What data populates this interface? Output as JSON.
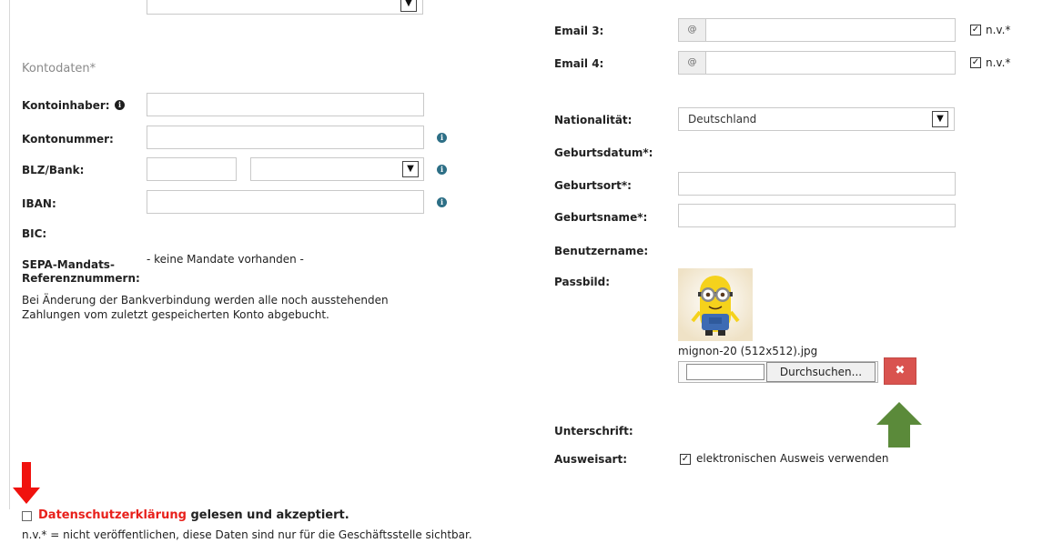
{
  "left": {
    "section_title": "Kontodaten*",
    "kontoinhaber_label": "Kontoinhaber:",
    "kontonummer_label": "Kontonummer:",
    "blz_label": "BLZ/Bank:",
    "iban_label": "IBAN:",
    "bic_label": "BIC:",
    "sepa_label_1": "SEPA-Mandats-",
    "sepa_label_2": "Referenznummern:",
    "sepa_value": "- keine Mandate vorhanden -",
    "note_line1": "Bei Änderung der Bankverbindung werden alle noch ausstehenden",
    "note_line2": "Zahlungen vom zuletzt gespeicherten Konto abgebucht."
  },
  "right": {
    "email3_label": "Email 3:",
    "email4_label": "Email 4:",
    "at_symbol": "@",
    "nv_label": "n.v.*",
    "nationalitaet_label": "Nationalität:",
    "nationalitaet_value": "Deutschland",
    "geburtsdatum_label": "Geburtsdatum*:",
    "geburtsort_label": "Geburtsort*:",
    "geburtsname_label": "Geburtsname*:",
    "benutzername_label": "Benutzername:",
    "passbild_label": "Passbild:",
    "photo_filename": "mignon-20 (512x512).jpg",
    "browse_button": "Durchsuchen...",
    "remove_symbol": "✖",
    "unterschrift_label": "Unterschrift:",
    "ausweisart_label": "Ausweisart:",
    "ausweis_checkbox_label": "elektronischen Ausweis verwenden"
  },
  "footer": {
    "privacy_link": "Datenschutzerklärung",
    "privacy_text": "gelesen und akzeptiert.",
    "nv_note": "n.v.* = nicht veröffentlichen, diese Daten sind nur für die Geschäftsstelle sichtbar."
  },
  "colors": {
    "red_arrow": "#f0120e",
    "green_arrow": "#5b8a3a",
    "remove_button": "#d9534f",
    "privacy_link": "#e8201b"
  },
  "icons": {
    "info": "info-icon",
    "check": "checkmark-icon",
    "dropdown": "chevron-down-icon"
  }
}
